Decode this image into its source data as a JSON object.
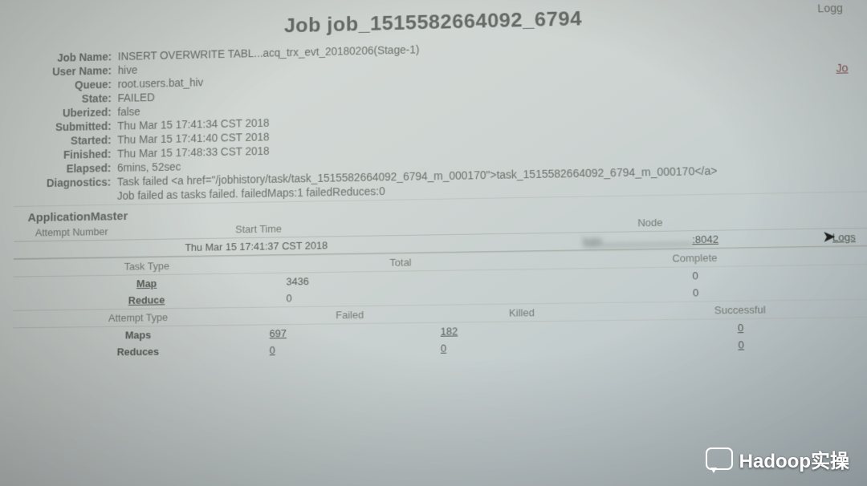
{
  "header": {
    "title_prefix": "Job",
    "job_id": "job_1515582664092_6794",
    "logged_label": "Logg"
  },
  "side_links": {
    "jo": "Jo",
    "logs": "Logs",
    "l": "L"
  },
  "overview": {
    "labels": {
      "job_name": "Job Name:",
      "user_name": "User Name:",
      "queue": "Queue:",
      "state": "State:",
      "uberized": "Uberized:",
      "submitted": "Submitted:",
      "started": "Started:",
      "finished": "Finished:",
      "elapsed": "Elapsed:",
      "diagnostics": "Diagnostics:"
    },
    "values": {
      "job_name": "INSERT OVERWRITE TABL...acq_trx_evt_20180206(Stage-1)",
      "user_name": "hive",
      "queue": "root.users.bat_hiv",
      "state": "FAILED",
      "uberized": "false",
      "submitted": "Thu Mar 15 17:41:34 CST 2018",
      "started": "Thu Mar 15 17:41:40 CST 2018",
      "finished": "Thu Mar 15 17:48:33 CST 2018",
      "elapsed": "6mins, 52sec",
      "diagnostics_1": "Task failed <a href=\"/jobhistory/task/task_1515582664092_6794_m_000170\">task_1515582664092_6794_m_000170</a>",
      "diagnostics_2": "Job failed as tasks failed. failedMaps:1 failedReduces:0"
    }
  },
  "appmaster": {
    "title": "ApplicationMaster",
    "headers": {
      "attempt": "Attempt Number",
      "start": "Start Time",
      "node": "Node"
    },
    "row": {
      "start": "Thu Mar 15 17:41:37 CST 2018",
      "node_obscured": "hdn......:8042",
      "node_port": ":8042"
    }
  },
  "tasks": {
    "headers": {
      "task_type": "Task Type",
      "total": "Total",
      "complete": "Complete"
    },
    "rows": [
      {
        "type": "Map",
        "total": "3436",
        "complete": "0"
      },
      {
        "type": "Reduce",
        "total": "0",
        "complete": "0"
      }
    ]
  },
  "attempts": {
    "headers": {
      "attempt_type": "Attempt Type",
      "failed": "Failed",
      "killed": "Killed",
      "successful": "Successful"
    },
    "rows": [
      {
        "type": "Maps",
        "failed": "697",
        "killed": "182",
        "successful": "0"
      },
      {
        "type": "Reduces",
        "failed": "0",
        "killed": "0",
        "successful": "0"
      }
    ]
  },
  "watermark": "Hadoop实操"
}
